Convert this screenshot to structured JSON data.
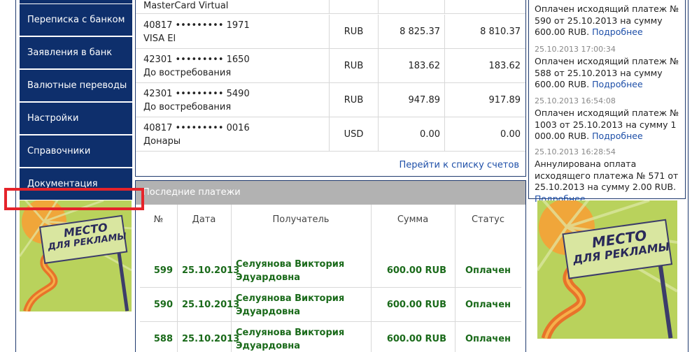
{
  "sidebar": {
    "items": [
      {
        "label": "Переписка с банком"
      },
      {
        "label": "Заявления в банк"
      },
      {
        "label": "Валютные переводы"
      },
      {
        "label": "Настройки"
      },
      {
        "label": "Справочники"
      },
      {
        "label": "Документация"
      }
    ]
  },
  "ad": {
    "line1": "МЕСТО",
    "line2": "ДЛЯ РЕКЛАМЫ"
  },
  "accounts": {
    "partial_row": {
      "name": "MasterCard Virtual"
    },
    "rows": [
      {
        "number": "40817 ••••••••• 1971",
        "name": "VISA El",
        "currency": "RUB",
        "balance": "8 825.37",
        "available": "8 810.37"
      },
      {
        "number": "42301 ••••••••• 1650",
        "name": "До востребования",
        "currency": "RUB",
        "balance": "183.62",
        "available": "183.62"
      },
      {
        "number": "42301 ••••••••• 5490",
        "name": "До востребования",
        "currency": "RUB",
        "balance": "947.89",
        "available": "917.89"
      },
      {
        "number": "40817 ••••••••• 0016",
        "name": "Донары",
        "currency": "USD",
        "balance": "0.00",
        "available": "0.00"
      }
    ],
    "link": "Перейти к списку счетов"
  },
  "payments": {
    "title": "Последние платежи",
    "columns": {
      "num": "№",
      "date": "Дата",
      "recipient": "Получатель",
      "amount": "Сумма",
      "status": "Статус"
    },
    "rows": [
      {
        "num": "599",
        "date": "25.10.2013",
        "recipient": "Селуянова Виктория Эдуардовна",
        "amount": "600.00 RUB",
        "status": "Оплачен"
      },
      {
        "num": "590",
        "date": "25.10.2013",
        "recipient": "Селуянова Виктория Эдуардовна",
        "amount": "600.00 RUB",
        "status": "Оплачен"
      },
      {
        "num": "588",
        "date": "25.10.2013",
        "recipient": "Селуянова Виктория Эдуардовна",
        "amount": "600.00 RUB",
        "status": "Оплачен"
      }
    ]
  },
  "news": {
    "items": [
      {
        "date": "",
        "text": "Оплачен исходящий платеж № 590 от 25.10.2013 на сумму 600.00 RUB.",
        "more": "Подробнее"
      },
      {
        "date": "25.10.2013 17:00:34",
        "text": "Оплачен исходящий платеж № 588 от 25.10.2013 на сумму 600.00 RUB.",
        "more": "Подробнее"
      },
      {
        "date": "25.10.2013 16:54:08",
        "text": "Оплачен исходящий платеж № 1003 от 25.10.2013 на сумму 1 000.00 RUB.",
        "more": "Подробнее"
      },
      {
        "date": "25.10.2013 16:28:54",
        "text": "Аннулирована оплата исходящего платежа № 571 от 25.10.2013 на сумму 2.00 RUB.",
        "more": "Подробнее"
      }
    ]
  }
}
